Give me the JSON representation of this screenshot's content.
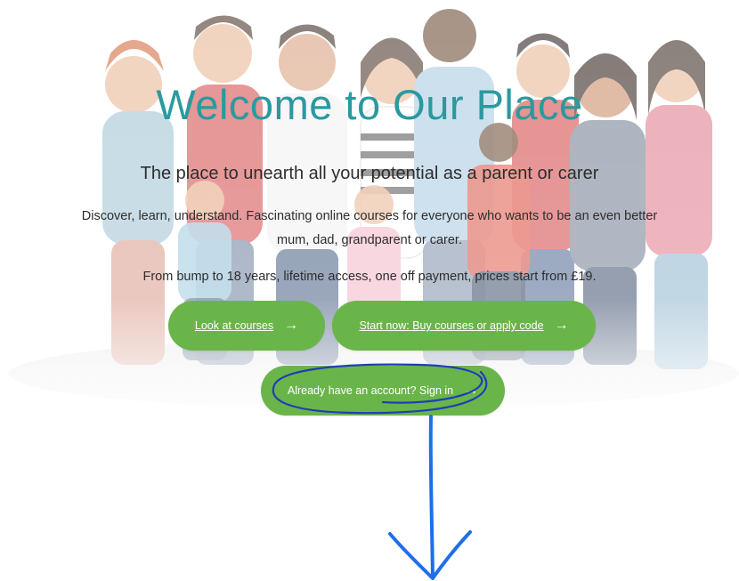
{
  "hero": {
    "title": "Welcome to Our Place",
    "subtitle": "The place to unearth all your potential as a parent or carer",
    "description": "Discover, learn, understand. Fascinating online courses for everyone who wants to be an even better mum, dad, grandparent or carer.",
    "pricing_note": "From bump to 18 years, lifetime access, one off payment, prices start from £19."
  },
  "buttons": {
    "look_courses": "Look at courses",
    "buy_courses": "Start now: Buy courses or apply code",
    "sign_in": "Already have an account? Sign in",
    "arrow": "→"
  },
  "colors": {
    "title": "#2a9a9f",
    "button": "#6ab54a",
    "annotation": "#1e5fe0"
  },
  "icons": [
    "arrow-right-icon",
    "down-arrow-annotation"
  ]
}
